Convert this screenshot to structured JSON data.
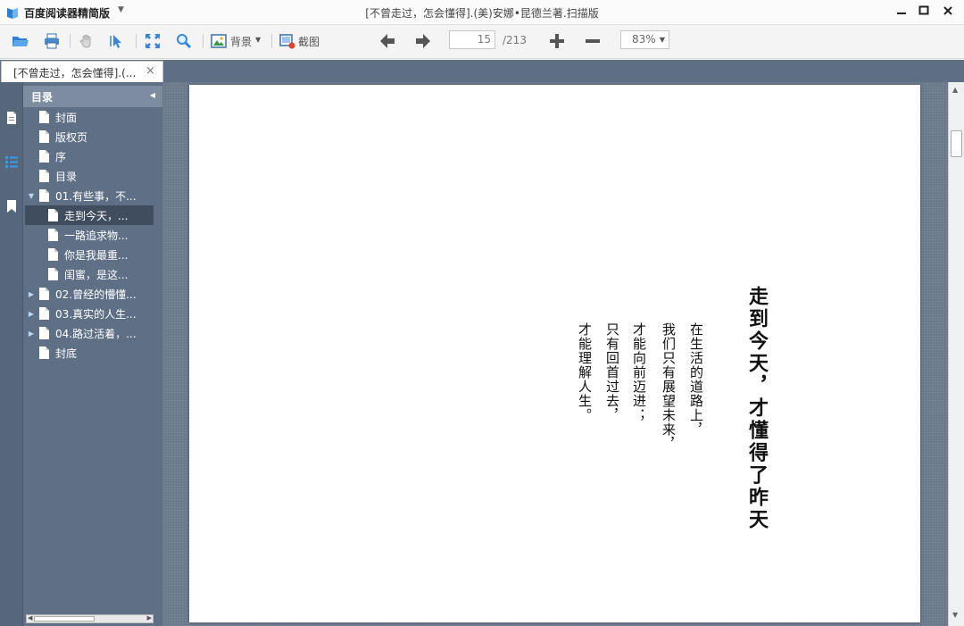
{
  "app": {
    "name": "百度阅读器精简版",
    "document_title": "[不曾走过，怎会懂得].(美)安娜•昆德兰著.扫描版",
    "icons": [
      "book-logo-icon",
      "chevron-down-icon",
      "minimize-icon",
      "maximize-icon",
      "close-icon"
    ]
  },
  "toolbar": {
    "background_label": "背景",
    "screenshot_label": "截图",
    "current_page": "15",
    "total_pages": "/213",
    "zoom": "83%"
  },
  "tab": {
    "label": "[不曾走过，怎会懂得].(...",
    "close": "×"
  },
  "toc": {
    "header": "目录",
    "items": [
      {
        "label": "封面"
      },
      {
        "label": "版权页"
      },
      {
        "label": "序"
      },
      {
        "label": "目录"
      },
      {
        "label": "01.有些事，不..."
      },
      {
        "label": "走到今天，..."
      },
      {
        "label": "一路追求物..."
      },
      {
        "label": "你是我最重..."
      },
      {
        "label": "闺蜜，是这..."
      },
      {
        "label": "02.曾经的懵懂..."
      },
      {
        "label": "03.真实的人生..."
      },
      {
        "label": "04.路过活着，..."
      },
      {
        "label": "封底"
      }
    ]
  },
  "page_content": {
    "title": "走到今天，才懂得了昨天",
    "lines": [
      "在生活的道路上，",
      "我们只有展望未来，",
      "才能向前迈进；",
      "只有回首过去，",
      "才能理解人生。"
    ]
  },
  "colors": {
    "accent": "#3a8fd8",
    "panel": "#5f7086",
    "panel_header": "#7d8ca0",
    "selected": "#3f4d5e"
  }
}
